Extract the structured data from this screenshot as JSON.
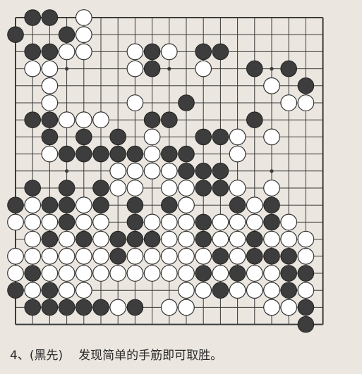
{
  "board": {
    "size": 19,
    "line_color": "#3a3a3a",
    "black_color": "#3d3d3d",
    "white_color": "#ffffff",
    "black_stones": [
      [
        1,
        0
      ],
      [
        2,
        0
      ],
      [
        0,
        1
      ],
      [
        3,
        1
      ],
      [
        1,
        2
      ],
      [
        2,
        2
      ],
      [
        8,
        2
      ],
      [
        11,
        2
      ],
      [
        12,
        2
      ],
      [
        14,
        3
      ],
      [
        16,
        3
      ],
      [
        8,
        3
      ],
      [
        17,
        4
      ],
      [
        10,
        5
      ],
      [
        1,
        6
      ],
      [
        2,
        6
      ],
      [
        8,
        6
      ],
      [
        9,
        6
      ],
      [
        14,
        6
      ],
      [
        2,
        7
      ],
      [
        4,
        7
      ],
      [
        6,
        7
      ],
      [
        11,
        7
      ],
      [
        12,
        7
      ],
      [
        3,
        8
      ],
      [
        4,
        8
      ],
      [
        5,
        8
      ],
      [
        6,
        8
      ],
      [
        7,
        8
      ],
      [
        9,
        8
      ],
      [
        10,
        8
      ],
      [
        11,
        9
      ],
      [
        12,
        9
      ],
      [
        10,
        9
      ],
      [
        1,
        10
      ],
      [
        3,
        10
      ],
      [
        5,
        10
      ],
      [
        12,
        10
      ],
      [
        11,
        10
      ],
      [
        0,
        11
      ],
      [
        2,
        11
      ],
      [
        3,
        11
      ],
      [
        5,
        11
      ],
      [
        7,
        11
      ],
      [
        9,
        11
      ],
      [
        13,
        11
      ],
      [
        15,
        11
      ],
      [
        3,
        12
      ],
      [
        7,
        12
      ],
      [
        11,
        12
      ],
      [
        15,
        12
      ],
      [
        2,
        13
      ],
      [
        6,
        13
      ],
      [
        7,
        13
      ],
      [
        8,
        13
      ],
      [
        11,
        13
      ],
      [
        14,
        13
      ],
      [
        4,
        13
      ],
      [
        6,
        14
      ],
      [
        12,
        14
      ],
      [
        14,
        14
      ],
      [
        15,
        14
      ],
      [
        16,
        14
      ],
      [
        1,
        15
      ],
      [
        11,
        15
      ],
      [
        13,
        15
      ],
      [
        16,
        15
      ],
      [
        17,
        15
      ],
      [
        0,
        16
      ],
      [
        2,
        16
      ],
      [
        12,
        16
      ],
      [
        16,
        16
      ],
      [
        1,
        17
      ],
      [
        2,
        17
      ],
      [
        3,
        17
      ],
      [
        4,
        17
      ],
      [
        5,
        17
      ],
      [
        7,
        17
      ],
      [
        17,
        17
      ],
      [
        17,
        18
      ]
    ],
    "white_stones": [
      [
        4,
        0
      ],
      [
        4,
        1
      ],
      [
        3,
        2
      ],
      [
        4,
        2
      ],
      [
        7,
        2
      ],
      [
        9,
        2
      ],
      [
        1,
        3
      ],
      [
        2,
        3
      ],
      [
        7,
        3
      ],
      [
        11,
        3
      ],
      [
        2,
        4
      ],
      [
        15,
        4
      ],
      [
        2,
        5
      ],
      [
        7,
        5
      ],
      [
        16,
        5
      ],
      [
        17,
        5
      ],
      [
        3,
        6
      ],
      [
        4,
        6
      ],
      [
        5,
        6
      ],
      [
        2,
        8
      ],
      [
        8,
        7
      ],
      [
        13,
        7
      ],
      [
        15,
        7
      ],
      [
        8,
        8
      ],
      [
        6,
        9
      ],
      [
        7,
        9
      ],
      [
        8,
        9
      ],
      [
        9,
        9
      ],
      [
        13,
        8
      ],
      [
        6,
        10
      ],
      [
        7,
        10
      ],
      [
        9,
        10
      ],
      [
        10,
        10
      ],
      [
        13,
        10
      ],
      [
        15,
        10
      ],
      [
        1,
        11
      ],
      [
        4,
        11
      ],
      [
        10,
        11
      ],
      [
        14,
        11
      ],
      [
        0,
        12
      ],
      [
        1,
        12
      ],
      [
        2,
        12
      ],
      [
        4,
        12
      ],
      [
        5,
        12
      ],
      [
        8,
        12
      ],
      [
        9,
        12
      ],
      [
        10,
        12
      ],
      [
        12,
        12
      ],
      [
        13,
        12
      ],
      [
        14,
        12
      ],
      [
        16,
        12
      ],
      [
        1,
        13
      ],
      [
        3,
        13
      ],
      [
        5,
        13
      ],
      [
        9,
        13
      ],
      [
        10,
        13
      ],
      [
        12,
        13
      ],
      [
        13,
        13
      ],
      [
        15,
        13
      ],
      [
        16,
        13
      ],
      [
        17,
        13
      ],
      [
        0,
        14
      ],
      [
        1,
        14
      ],
      [
        2,
        14
      ],
      [
        3,
        14
      ],
      [
        4,
        14
      ],
      [
        5,
        14
      ],
      [
        7,
        14
      ],
      [
        8,
        14
      ],
      [
        9,
        14
      ],
      [
        10,
        14
      ],
      [
        11,
        14
      ],
      [
        13,
        14
      ],
      [
        17,
        14
      ],
      [
        0,
        15
      ],
      [
        2,
        15
      ],
      [
        3,
        15
      ],
      [
        4,
        15
      ],
      [
        5,
        15
      ],
      [
        6,
        15
      ],
      [
        7,
        15
      ],
      [
        8,
        15
      ],
      [
        9,
        15
      ],
      [
        10,
        15
      ],
      [
        12,
        15
      ],
      [
        14,
        15
      ],
      [
        15,
        15
      ],
      [
        1,
        16
      ],
      [
        3,
        16
      ],
      [
        4,
        16
      ],
      [
        10,
        16
      ],
      [
        11,
        16
      ],
      [
        13,
        16
      ],
      [
        14,
        16
      ],
      [
        15,
        16
      ],
      [
        17,
        16
      ],
      [
        6,
        17
      ],
      [
        9,
        17
      ],
      [
        10,
        17
      ],
      [
        15,
        17
      ],
      [
        16,
        17
      ]
    ],
    "star_points": [
      [
        3,
        3
      ],
      [
        9,
        3
      ],
      [
        15,
        3
      ],
      [
        3,
        9
      ],
      [
        9,
        9
      ],
      [
        15,
        9
      ],
      [
        3,
        15
      ],
      [
        9,
        15
      ],
      [
        15,
        15
      ]
    ]
  },
  "caption": {
    "problem_label": "4、(黑先)",
    "instruction": "发现简单的手筋即可取胜。"
  }
}
